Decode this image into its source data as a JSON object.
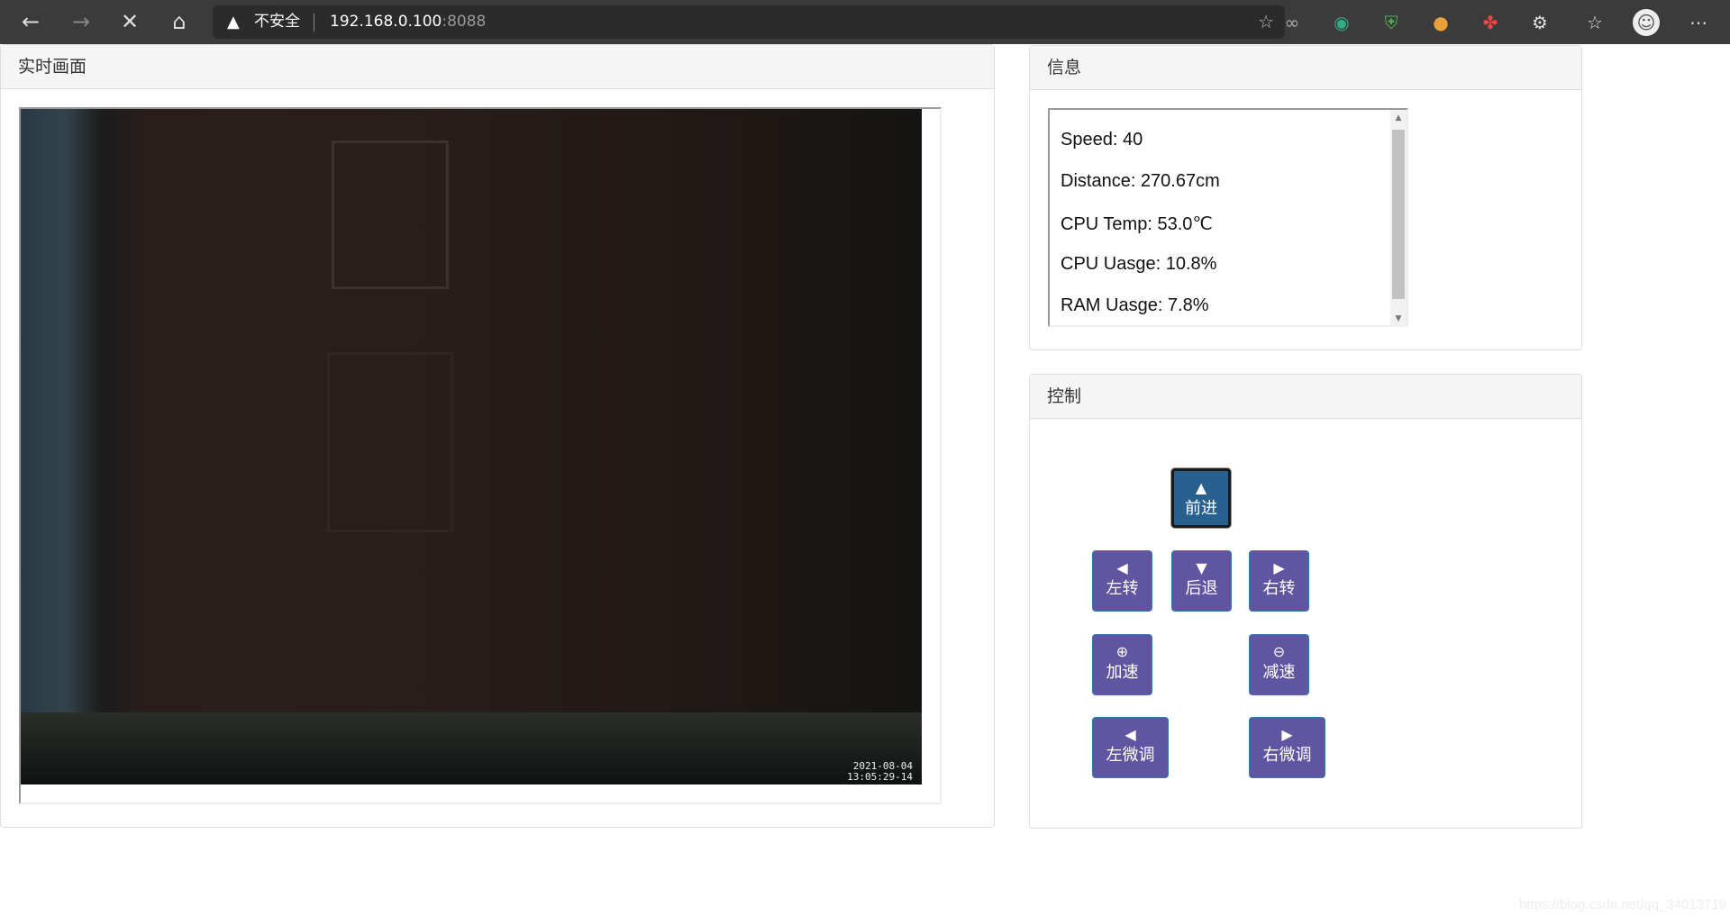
{
  "browser": {
    "insecure_label": "不安全",
    "url_host": "192.168.0.100",
    "url_port": ":8088",
    "icons": [
      "back-icon",
      "forward-icon",
      "stop-icon",
      "home-icon",
      "warning-icon",
      "add-favorite-icon",
      "infinity-extension-icon",
      "globe-extension-icon",
      "shield-extension-icon",
      "ball-extension-icon",
      "pinwheel-extension-icon",
      "extensions-icon",
      "favorites-icon",
      "profile-avatar",
      "more-icon"
    ]
  },
  "video_panel": {
    "title": "实时画面",
    "timestamp_date": "2021-08-04",
    "timestamp_time": "13:05:29-14"
  },
  "info_panel": {
    "title": "信息",
    "lines": [
      "Speed: 40",
      "Distance: 270.67cm",
      "CPU Temp: 53.0℃",
      "CPU Uasge: 10.8%",
      "RAM Uasge: 7.8%"
    ]
  },
  "control_panel": {
    "title": "控制",
    "buttons": {
      "forward": "前进",
      "left": "左转",
      "backward": "后退",
      "right": "右转",
      "speed_up": "加速",
      "slow_down": "减速",
      "fine_left": "左微调",
      "fine_right": "右微调"
    }
  },
  "colors": {
    "button": "#5f55a0",
    "button_active": "#286090"
  },
  "watermark": "https://blog.csdn.net/qq_34013719"
}
